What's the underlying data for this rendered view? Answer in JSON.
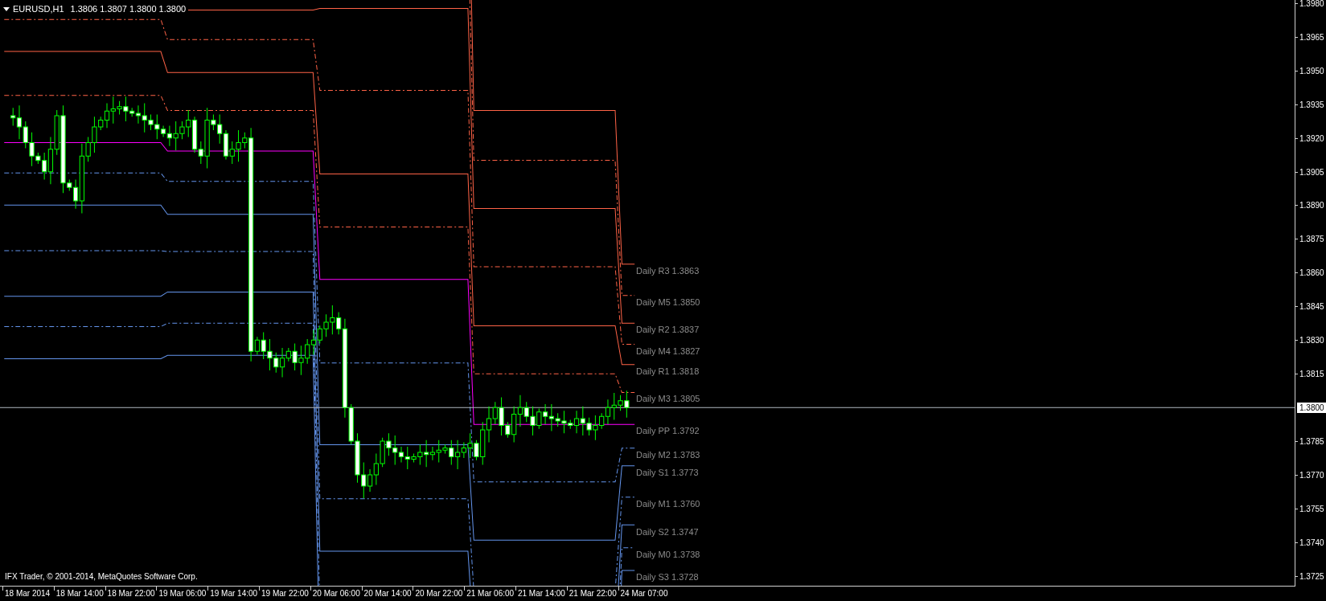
{
  "header": {
    "symbol": "EURUSD,H1",
    "quotes": [
      "1.3806",
      "1.3807",
      "1.3800",
      "1.3800"
    ]
  },
  "level_labels": [
    {
      "text": "Daily R3 1.3863"
    },
    {
      "text": "Daily M5 1.3850"
    },
    {
      "text": "Daily R2 1.3837"
    },
    {
      "text": "Daily M4 1.3827"
    },
    {
      "text": "Daily R1 1.3818"
    },
    {
      "text": "Daily M3 1.3805"
    },
    {
      "text": "Daily PP 1.3792"
    },
    {
      "text": "Daily M2 1.3783"
    },
    {
      "text": "Daily S1 1.3773"
    },
    {
      "text": "Daily M1 1.3760"
    },
    {
      "text": "Daily S2 1.3747"
    },
    {
      "text": "Daily M0 1.3738"
    },
    {
      "text": "Daily S3 1.3728"
    }
  ],
  "copyright": "IFX Trader, © 2001-2014, MetaQuotes Software Corp.",
  "price_axis": [
    "1.3980",
    "1.3965",
    "1.3950",
    "1.3935",
    "1.3920",
    "1.3905",
    "1.3890",
    "1.3875",
    "1.3860",
    "1.3845",
    "1.3830",
    "1.3815",
    "1.3785",
    "1.3770",
    "1.3755",
    "1.3740",
    "1.3725"
  ],
  "current_price": "1.3800",
  "time_axis": [
    "18 Mar 2014",
    "18 Mar 14:00",
    "18 Mar 22:00",
    "19 Mar 06:00",
    "19 Mar 14:00",
    "19 Mar 22:00",
    "20 Mar 06:00",
    "20 Mar 14:00",
    "20 Mar 22:00",
    "21 Mar 06:00",
    "21 Mar 14:00",
    "21 Mar 22:00",
    "24 Mar 07:00"
  ]
}
